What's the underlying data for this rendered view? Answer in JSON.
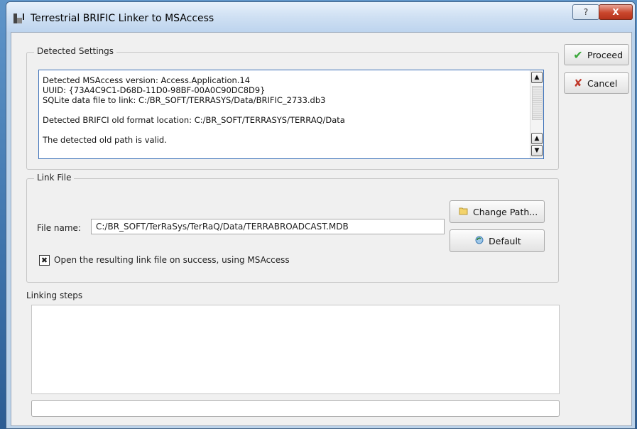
{
  "window": {
    "title": "Terrestrial BRIFIC Linker to MSAccess",
    "help_label": "?",
    "close_label": "X"
  },
  "detected_settings": {
    "legend": "Detected Settings",
    "log_text": "Detected MSAccess version: Access.Application.14\nUUID: {73A4C9C1-D68D-11D0-98BF-00A0C90DC8D9}\nSQLite data file to link: C:/BR_SOFT/TERRASYS/Data/BRIFIC_2733.db3\n\nDetected BRIFCI old format location: C:/BR_SOFT/TERRASYS/TERRAQ/Data\n\nThe detected old path is valid."
  },
  "actions": {
    "proceed_label": "Proceed",
    "cancel_label": "Cancel"
  },
  "link_file": {
    "legend": "Link File",
    "file_name_label": "File name:",
    "file_name_value": "C:/BR_SOFT/TerRaSys/TerRaQ/Data/TERRABROADCAST.MDB",
    "change_path_label": "Change Path...",
    "default_label": "Default",
    "open_checkbox_label": "Open the resulting link file on success, using MSAccess",
    "open_checked": true
  },
  "linking_steps": {
    "label": "Linking steps",
    "content": ""
  },
  "colors": {
    "accent_border": "#3b6fb8",
    "close_red": "#c9462c",
    "proceed_green": "#3aa83a",
    "cancel_red": "#c0392b"
  },
  "icons": [
    "app-icon",
    "help-icon",
    "close-icon",
    "checkmark-icon",
    "x-mark-icon",
    "folder-icon",
    "refresh-icon",
    "up-arrow-icon",
    "down-arrow-icon"
  ]
}
